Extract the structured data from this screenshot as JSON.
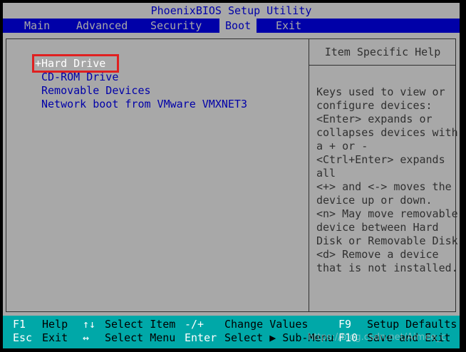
{
  "title": "PhoenixBIOS Setup Utility",
  "menu": [
    "Main",
    "Advanced",
    "Security",
    "Boot",
    "Exit"
  ],
  "active_menu": "Boot",
  "boot": {
    "items": [
      {
        "prefix": "+",
        "label": "Hard Drive"
      },
      {
        "prefix": "",
        "label": "CD-ROM Drive"
      },
      {
        "prefix": "",
        "label": "Removable Devices"
      },
      {
        "prefix": "",
        "label": "Network boot from VMware VMXNET3"
      }
    ]
  },
  "help": {
    "title": "Item Specific Help",
    "text": "Keys used to view or\nconfigure devices:\n<Enter> expands or\ncollapses devices with\na + or -\n<Ctrl+Enter> expands\nall\n<+> and <-> moves the\ndevice up or down.\n<n> May move removable\ndevice between Hard\nDisk or Removable Disk\n<d> Remove a device\nthat is not installed."
  },
  "footer": {
    "row1": [
      {
        "key": "F1",
        "label": "Help"
      },
      {
        "key": "↑↓",
        "label": "Select Item"
      },
      {
        "key": "-/+",
        "label": "Change Values"
      },
      {
        "key": "F9",
        "label": "Setup Defaults"
      }
    ],
    "row2": [
      {
        "key": "Esc",
        "label": "Exit"
      },
      {
        "key": "↔",
        "label": "Select Menu"
      },
      {
        "key": "Enter",
        "label": "Select ▶ Sub-Menu"
      },
      {
        "key": "F10",
        "label": "Save and Exit"
      }
    ]
  },
  "watermark": "https://blog.csdn.net/Aimee_c",
  "colors": {
    "bios_gray": "#a8a8a8",
    "bios_blue": "#0000a8",
    "footer_cyan": "#00a8a8",
    "highlight_red": "#e02020"
  }
}
